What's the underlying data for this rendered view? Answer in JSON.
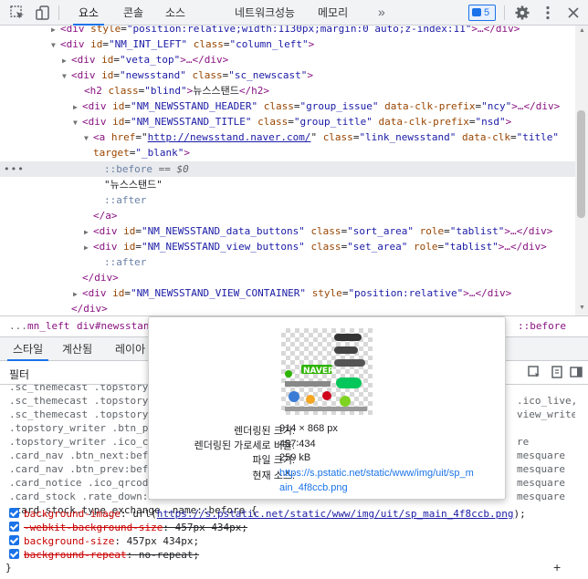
{
  "toolbar": {
    "tabs": [
      "요소",
      "콘솔",
      "소스",
      "네트워크",
      "성능",
      "메모리"
    ],
    "badge_count": "5"
  },
  "tree": {
    "l1": {
      "tag_open": "<div",
      "a1": "style",
      "v1": "\"position:relative;width:1130px;margin:0 auto;z-index:11\"",
      "tail": ">…</div>"
    },
    "l2": {
      "tag_open": "<div",
      "a1": "id",
      "v1": "\"NM_INT_LEFT\"",
      "a2": "class",
      "v2": "\"column_left\"",
      "tail": ">"
    },
    "l3": {
      "tag_open": "<div",
      "a1": "id",
      "v1": "\"veta_top\"",
      "tail": ">…</div>"
    },
    "l4": {
      "tag_open": "<div",
      "a1": "id",
      "v1": "\"newsstand\"",
      "a2": "class",
      "v2": "\"sc_newscast\"",
      "tail": ">"
    },
    "l5": {
      "tag_open": "<h2",
      "a1": "class",
      "v1": "\"blind\"",
      "text": "뉴스스탠드",
      "tail": "</h2>"
    },
    "l6": {
      "tag_open": "<div",
      "a1": "id",
      "v1": "\"NM_NEWSSTAND_HEADER\"",
      "a2": "class",
      "v2": "\"group_issue\"",
      "a3": "data-clk-prefix",
      "v3": "\"ncy\"",
      "tail": ">…</div>"
    },
    "l7": {
      "tag_open": "<div",
      "a1": "id",
      "v1": "\"NM_NEWSSTAND_TITLE\"",
      "a2": "class",
      "v2": "\"group_title\"",
      "a3": "data-clk-prefix",
      "v3": "\"nsd\"",
      "tail": ">"
    },
    "l8": {
      "tag_open": "<a",
      "a1": "href",
      "v1": "http://newsstand.naver.com/",
      "a2": "class",
      "v2": "\"link_newsstand\"",
      "a3": "data-clk",
      "v3": "\"title\""
    },
    "l9": {
      "a1": "target",
      "v1": "\"_blank\"",
      "tail": ">"
    },
    "l10": {
      "text": "::before",
      "eq": "== $0"
    },
    "l11": {
      "text": "\"뉴스스탠드\""
    },
    "l12": {
      "text": "::after"
    },
    "l13": {
      "text": "</a>"
    },
    "l14": {
      "tag_open": "<div",
      "a1": "id",
      "v1": "\"NM_NEWSSTAND_data_buttons\"",
      "a2": "class",
      "v2": "\"sort_area\"",
      "a3": "role",
      "v3": "\"tablist\"",
      "tail": ">…</div>"
    },
    "l15": {
      "tag_open": "<div",
      "a1": "id",
      "v1": "\"NM_NEWSSTAND_view_buttons\"",
      "a2": "class",
      "v2": "\"set_area\"",
      "a3": "role",
      "v3": "\"tablist\"",
      "tail": ">…</div>"
    },
    "l16": {
      "text": "::after"
    },
    "l17": {
      "text": "</div>"
    },
    "l18": {
      "tag_open": "<div",
      "a1": "id",
      "v1": "\"NM_NEWSSTAND_VIEW_CONTAINER\"",
      "a2": "style",
      "v2": "\"position:relative\"",
      "tail": ">…</div>"
    },
    "l19": {
      "text": "</div>"
    }
  },
  "breadcrumb": {
    "items": [
      "...",
      "mn_left",
      "div#newsstand",
      "::before"
    ]
  },
  "styles": {
    "tabs": [
      "스타일",
      "계산됨",
      "레이아"
    ],
    "filter_label": "필터",
    "rule_lines": [
      ".sc_themecast .topstory_",
      ".sc_themecast .topstory_",
      ".sc_themecast .topstory_",
      ".topstory_writer .btn_p",
      ".topstory_writer .ico_c",
      ".card_nav .btn_next:bef",
      ".card_nav .btn_prev:bef",
      ".card_notice .ico_qrcode",
      ".card_stock .rate_down:b",
      ".card_stock.type_exchange .name::before {"
    ],
    "rule_right": [
      ".ico_live,",
      "view_writer",
      "",
      "",
      "re",
      "mesquare",
      "mesquare",
      "mesquare",
      "mesquare"
    ],
    "decls": [
      {
        "name": "background-image",
        "value": "url(",
        "link": "https://s.pstatic.net/static/www/img/uit/sp_main_4f8ccb.png",
        "close": ");",
        "struck": false
      },
      {
        "name": "-webkit-background-size",
        "value": "457px 434px;",
        "struck": true
      },
      {
        "name": "background-size",
        "value": "457px 434px;",
        "struck": false
      },
      {
        "name": "background-repeat",
        "value": "no-repeat;",
        "struck": true
      }
    ],
    "close_brace": "}"
  },
  "tooltip": {
    "thumb_text": "NAVER",
    "rows": [
      {
        "label": "렌더링된 크기:",
        "value": "914 × 868 px"
      },
      {
        "label": "렌더링된 가로세로 비율:",
        "value": "457∶434"
      },
      {
        "label": "파일 크기:",
        "value": "259 kB"
      },
      {
        "label": "현재 소스:",
        "value": "https://s.pstatic.net/static/www/img/uit/sp_main_4f8ccb.png"
      }
    ],
    "source_line1": "https://s.pstatic.net/static/www/img/uit/sp_m",
    "source_line2": "ain_4f8ccb.png"
  }
}
